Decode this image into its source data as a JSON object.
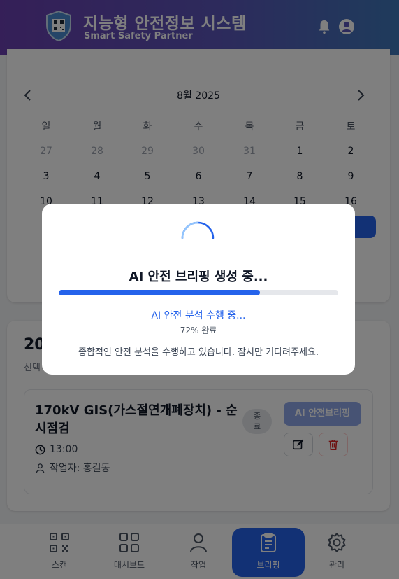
{
  "header": {
    "title": "지능형 안전정보 시스템",
    "subtitle": "Smart Safety Partner",
    "icons": [
      "shield-qr-logo",
      "bell-icon",
      "account-icon"
    ]
  },
  "calendar": {
    "month_label": "8월 2025",
    "weekdays": [
      "일",
      "월",
      "화",
      "수",
      "목",
      "금",
      "토"
    ],
    "weeks": [
      [
        "27",
        "28",
        "29",
        "30",
        "31",
        "1",
        "2"
      ],
      [
        "3",
        "4",
        "5",
        "6",
        "7",
        "8",
        "9"
      ],
      [
        "10",
        "11",
        "12",
        "13",
        "14",
        "15",
        "16"
      ]
    ],
    "muted_days": [
      "27",
      "28",
      "29",
      "30",
      "31"
    ]
  },
  "schedule": {
    "date_heading": "20",
    "sub_heading": "선택",
    "task": {
      "title": "170kV GIS(가스절연개폐장치) - 순시점검",
      "status": "종료",
      "time": "13:00",
      "worker": "작업자: 홍길동",
      "ai_button": "AI 안전브리핑"
    }
  },
  "bottom_nav": {
    "items": [
      {
        "label": "스캔",
        "icon": "qr-scan-icon"
      },
      {
        "label": "대시보드",
        "icon": "dashboard-icon"
      },
      {
        "label": "작업",
        "icon": "user-icon"
      },
      {
        "label": "브리핑",
        "icon": "clipboard-icon"
      },
      {
        "label": "관리",
        "icon": "gear-icon"
      }
    ],
    "active": "브리핑"
  },
  "modal": {
    "title": "AI 안전 브리핑 생성 중...",
    "progress": 0.72,
    "step": "AI 안전 분석 수행 중...",
    "percent_label": "72% 완료",
    "description": "종합적인 안전 분석을 수행하고 있습니다. 잠시만 기다려주세요."
  },
  "colors": {
    "header_start": "#6a3fb0",
    "header_end": "#3e77b8",
    "accent": "#2563eb"
  }
}
